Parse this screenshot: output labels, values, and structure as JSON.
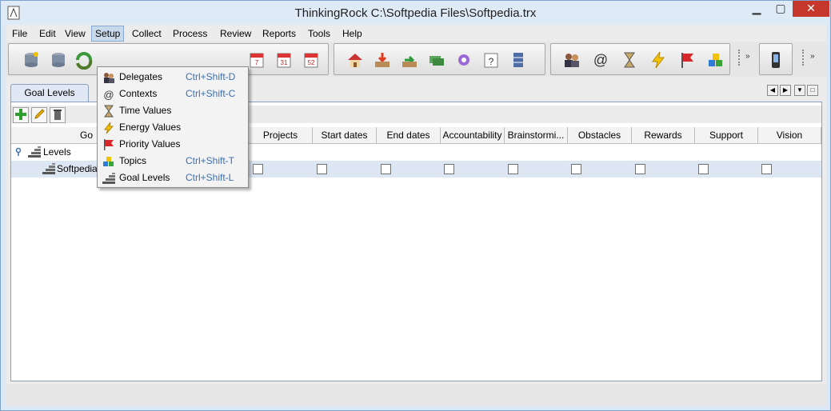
{
  "window": {
    "title": "ThinkingRock C:\\Softpedia Files\\Softpedia.trx"
  },
  "menubar": {
    "items": [
      {
        "label": "File"
      },
      {
        "label": "Edit"
      },
      {
        "label": "View"
      },
      {
        "label": "Setup"
      },
      {
        "label": "Collect"
      },
      {
        "label": "Process"
      },
      {
        "label": "Review"
      },
      {
        "label": "Reports"
      },
      {
        "label": "Tools"
      },
      {
        "label": "Help"
      }
    ],
    "active": "Setup"
  },
  "setup_menu": [
    {
      "label": "Delegates",
      "shortcut": "Ctrl+Shift-D",
      "icon": "delegates-icon"
    },
    {
      "label": "Contexts",
      "shortcut": "Ctrl+Shift-C",
      "icon": "at-icon"
    },
    {
      "label": "Time Values",
      "shortcut": "",
      "icon": "hourglass-icon"
    },
    {
      "label": "Energy Values",
      "shortcut": "",
      "icon": "lightning-icon"
    },
    {
      "label": "Priority Values",
      "shortcut": "",
      "icon": "flag-icon"
    },
    {
      "label": "Topics",
      "shortcut": "Ctrl+Shift-T",
      "icon": "topics-icon"
    },
    {
      "label": "Goal Levels",
      "shortcut": "Ctrl+Shift-L",
      "icon": "stairs-icon"
    }
  ],
  "tab": {
    "label": "Goal Levels"
  },
  "table": {
    "columns": [
      "Go",
      "n",
      "Projects",
      "Start dates",
      "End dates",
      "Accountability",
      "Brainstormi...",
      "Obstacles",
      "Rewards",
      "Support",
      "Vision"
    ],
    "rows": [
      {
        "label": "Levels",
        "type": "root"
      },
      {
        "label": "Softpedia",
        "type": "child"
      }
    ]
  },
  "colors": {
    "accent": "#3c6fb0",
    "selected_row": "#dde7f3",
    "close_button": "#c7382c"
  }
}
